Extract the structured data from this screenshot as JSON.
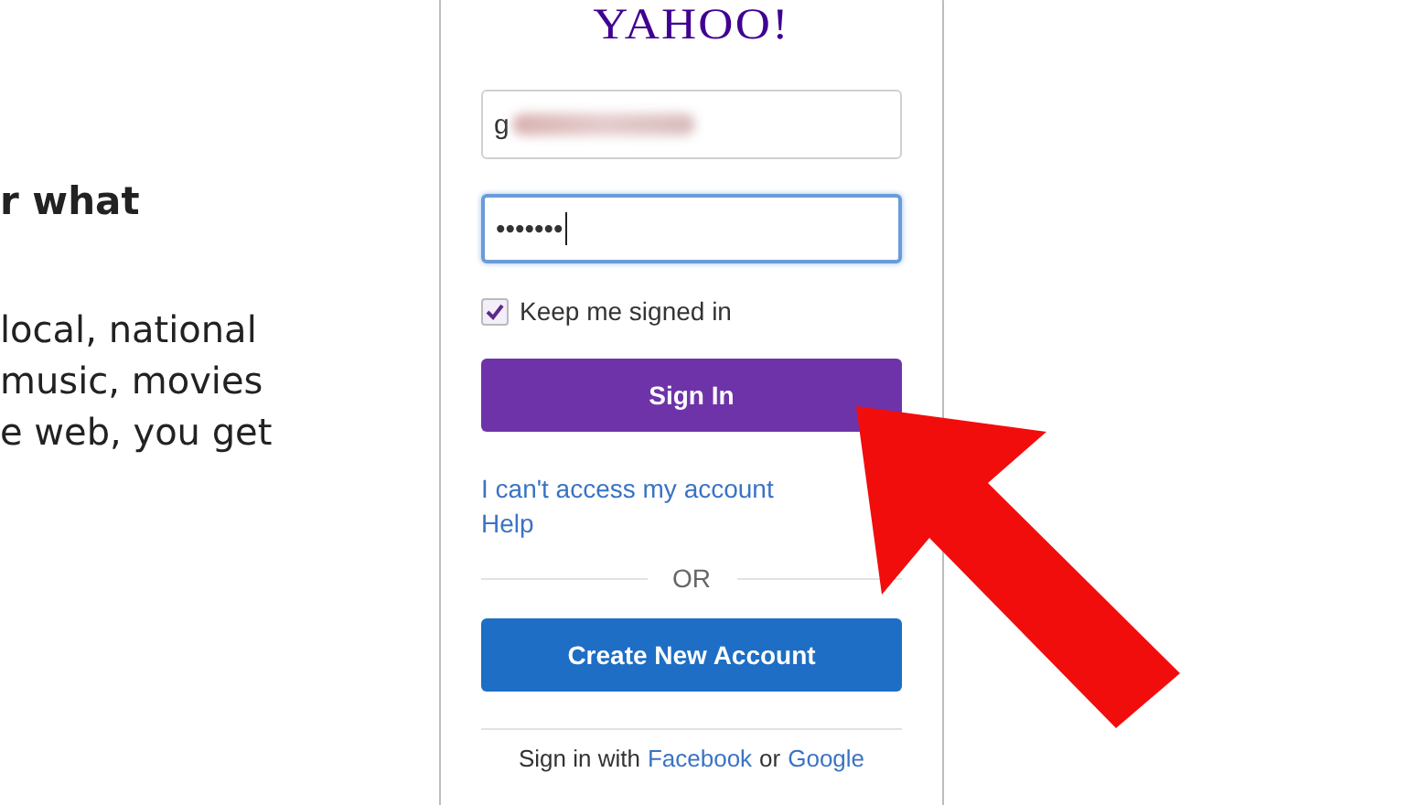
{
  "article": {
    "heading": "r what",
    "lines": [
      "local, national",
      "music, movies",
      "e web, you get"
    ]
  },
  "login": {
    "logo": "YAHOO!",
    "username": {
      "value": "g",
      "obscured": true,
      "focused": false
    },
    "password": {
      "value": "•••••••",
      "focused": true
    },
    "keep_signed_in": {
      "label": "Keep me signed in",
      "checked": true
    },
    "sign_in": "Sign In",
    "links": [
      "I can't access my account",
      "Help"
    ],
    "divider": "OR",
    "create_account": "Create New Account",
    "social": {
      "prefix": "Sign in with",
      "facebook": "Facebook",
      "joiner": "or",
      "google": "Google"
    }
  },
  "annotation": {
    "kind": "arrow"
  }
}
